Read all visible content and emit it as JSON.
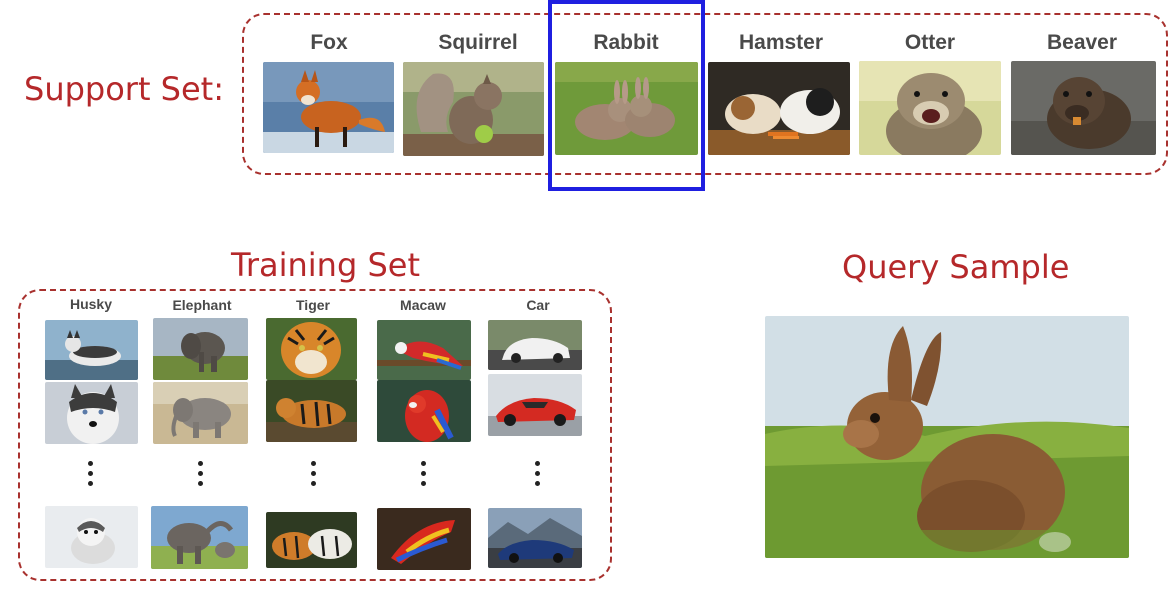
{
  "support_set": {
    "title": "Support Set:",
    "classes": [
      {
        "label": "Fox",
        "image": "fox-photo"
      },
      {
        "label": "Squirrel",
        "image": "squirrel-photo"
      },
      {
        "label": "Rabbit",
        "image": "rabbit-photo"
      },
      {
        "label": "Hamster",
        "image": "hamster-photo"
      },
      {
        "label": "Otter",
        "image": "otter-photo"
      },
      {
        "label": "Beaver",
        "image": "beaver-photo"
      }
    ],
    "highlighted_class": "Rabbit",
    "highlight_color": "#1f1fe0"
  },
  "training_set": {
    "title": "Training Set",
    "columns": [
      {
        "label": "Husky",
        "images": [
          "husky-photo",
          "husky-photo",
          "husky-puppy-photo"
        ]
      },
      {
        "label": "Elephant",
        "images": [
          "elephant-photo",
          "elephant-photo",
          "elephant-family-photo"
        ]
      },
      {
        "label": "Tiger",
        "images": [
          "tiger-photo",
          "tiger-photo",
          "tigers-pair-photo"
        ]
      },
      {
        "label": "Macaw",
        "images": [
          "macaw-photo",
          "macaw-photo",
          "macaw-photo"
        ]
      },
      {
        "label": "Car",
        "images": [
          "white-car-photo",
          "red-car-photo",
          "blue-car-photo"
        ]
      }
    ],
    "ellipsis": "⋮"
  },
  "query": {
    "title": "Query Sample",
    "image": "rabbit-photo"
  },
  "colors": {
    "title_red": "#b5282a",
    "dashed_border": "#a8312e",
    "label_gray": "#4a4a4a"
  }
}
